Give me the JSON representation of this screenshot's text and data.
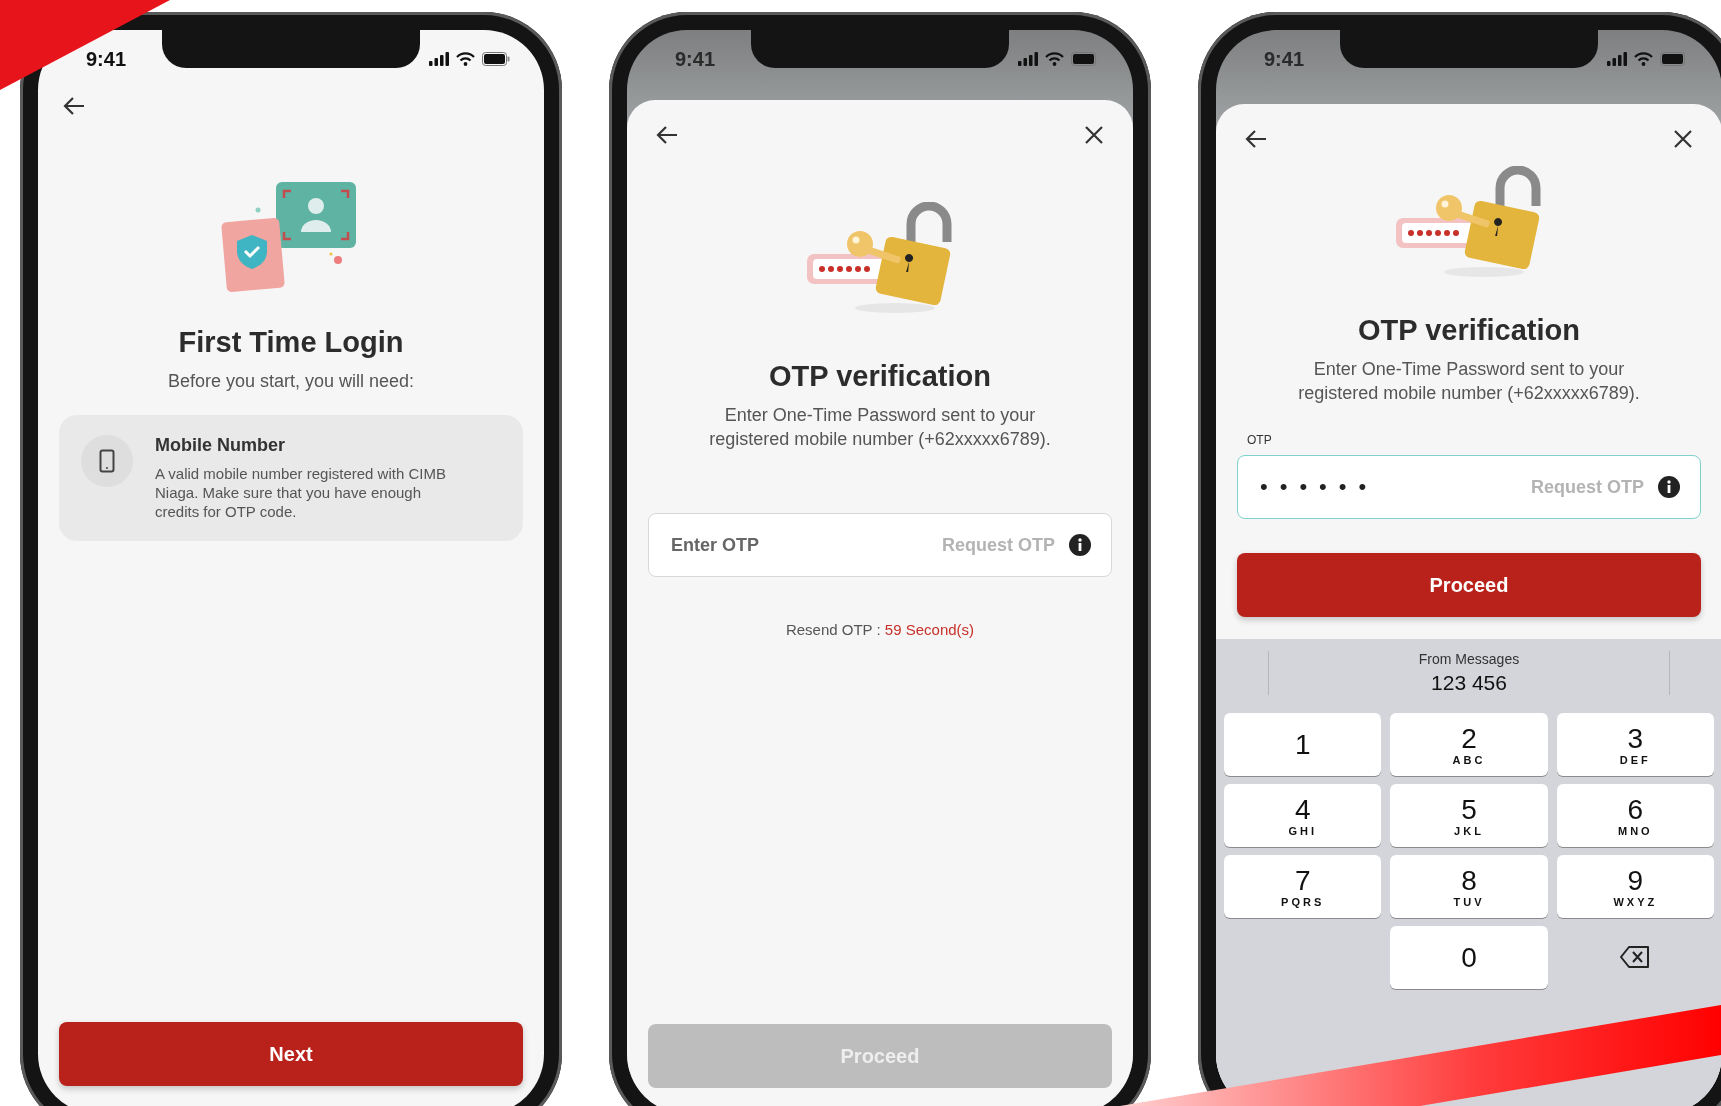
{
  "screens": [
    {
      "kind": "intro",
      "status_time": "9:41",
      "title": "First Time Login",
      "subtitle": "Before you start, you will need:",
      "requirements": [
        {
          "title": "Mobile Number",
          "description": "A valid mobile number registered with CIMB Niaga. Make sure that you have enough credits for OTP code."
        }
      ],
      "primary_button": {
        "label": "Next",
        "disabled": false
      }
    },
    {
      "kind": "otp",
      "status_time": "9:41",
      "title": "OTP verification",
      "description": "Enter One-Time Password sent to your registered mobile number (+62xxxxx6789).",
      "otp_field": {
        "placeholder": "Enter OTP",
        "action": "Request OTP",
        "focused": false
      },
      "resend": {
        "label": "Resend OTP :",
        "countdown": "59 Second(s)"
      },
      "primary_button": {
        "label": "Proceed",
        "disabled": true
      }
    },
    {
      "kind": "otp",
      "status_time": "9:41",
      "title": "OTP verification",
      "description": "Enter One-Time Password sent to your registered mobile number (+62xxxxx6789).",
      "otp_field": {
        "label": "OTP",
        "value": "••••••",
        "action": "Request OTP",
        "focused": true
      },
      "primary_button": {
        "label": "Proceed",
        "disabled": false
      },
      "keyboard": {
        "suggestion_source": "From Messages",
        "suggestion": "123 456",
        "keys": [
          {
            "digit": "1"
          },
          {
            "digit": "2",
            "letters": "ABC"
          },
          {
            "digit": "3",
            "letters": "DEF"
          },
          {
            "digit": "4",
            "letters": "GHI"
          },
          {
            "digit": "5",
            "letters": "JKL"
          },
          {
            "digit": "6",
            "letters": "MNO"
          },
          {
            "digit": "7",
            "letters": "PQRS"
          },
          {
            "digit": "8",
            "letters": "TUV"
          },
          {
            "digit": "9",
            "letters": "WXYZ"
          },
          {
            "digit": "0"
          }
        ]
      }
    }
  ]
}
